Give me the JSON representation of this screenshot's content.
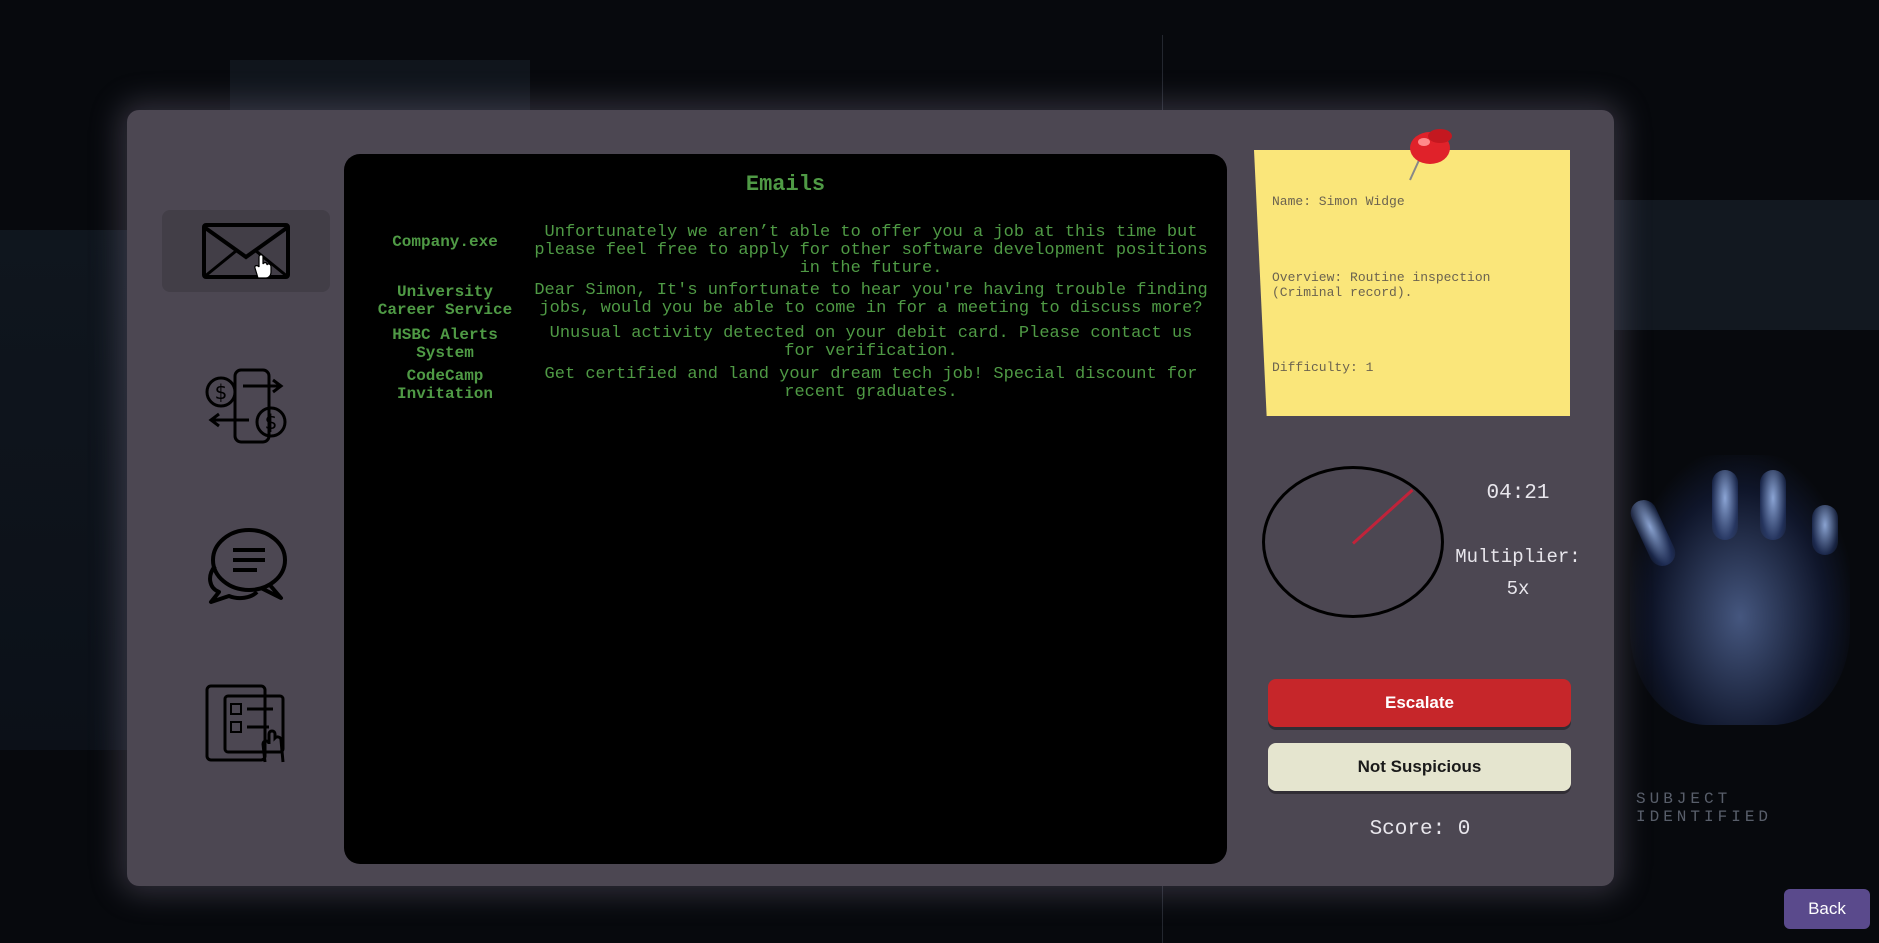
{
  "background": {
    "subject_text": "SUBJECT IDENTIFIED"
  },
  "sidebar": {
    "items": [
      {
        "icon": "envelope-icon",
        "active": true
      },
      {
        "icon": "money-transfer-icon",
        "active": false
      },
      {
        "icon": "chat-bubbles-icon",
        "active": false
      },
      {
        "icon": "checklist-tablet-icon",
        "active": false
      }
    ]
  },
  "screen": {
    "title": "Emails",
    "emails": [
      {
        "sender": "Company.exe",
        "body": "Unfortunately we aren’t able to offer you a job at this time but please feel free to apply for other software development positions in the future."
      },
      {
        "sender": "University Career Service",
        "body": "Dear Simon, It's unfortunate to hear you're having trouble finding jobs, would you be able to come in for a meeting to discuss more?"
      },
      {
        "sender": "HSBC Alerts System",
        "body": "Unusual activity detected on your debit card. Please contact us for verification."
      },
      {
        "sender": "CodeCamp Invitation",
        "body": "Get certified and land your dream tech job! Special discount for recent graduates."
      }
    ]
  },
  "case_note": {
    "name": "Name: Simon Widge",
    "overview": "Overview: Routine inspection (Criminal record).",
    "difficulty": "Difficulty: 1"
  },
  "status": {
    "timer": "04:21",
    "multiplier_label": "Multiplier:",
    "multiplier_value": "5x",
    "score": "Score: 0"
  },
  "actions": {
    "escalate_label": "Escalate",
    "not_suspicious_label": "Not Suspicious",
    "back_label": "Back"
  },
  "colors": {
    "terminal_green": "#4f9a45",
    "escalate_red": "#c6262a",
    "sticky_yellow": "#fae67a",
    "back_purple": "#5a4a8c"
  }
}
